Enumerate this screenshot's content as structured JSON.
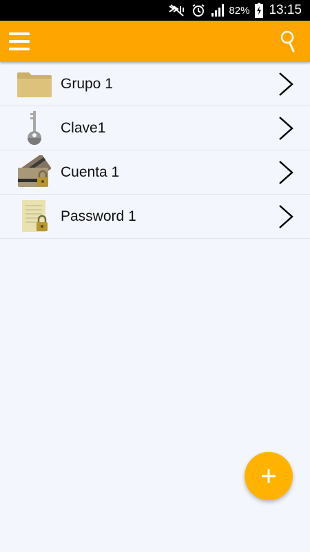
{
  "status_bar": {
    "battery_percent": "82%",
    "time": "13:15",
    "icons": [
      "nfc-mute-icon",
      "alarm-icon",
      "signal-icon",
      "battery-charging-icon"
    ]
  },
  "app_bar": {
    "color": "#ffa500",
    "menu_icon": "hamburger-menu-icon",
    "search_icon": "search-icon"
  },
  "list": {
    "items": [
      {
        "label": "Grupo 1",
        "icon": "folder-icon"
      },
      {
        "label": "Clave1",
        "icon": "key-icon"
      },
      {
        "label": "Cuenta 1",
        "icon": "credit-card-lock-icon"
      },
      {
        "label": "Password 1",
        "icon": "document-lock-icon"
      }
    ]
  },
  "fab": {
    "label": "+",
    "color": "#ffb300"
  }
}
